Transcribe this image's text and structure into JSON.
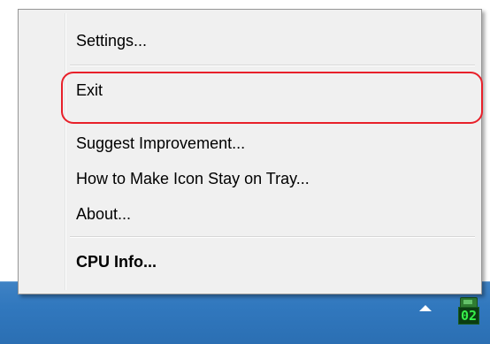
{
  "menu": {
    "items": [
      {
        "label": "Settings..."
      },
      {
        "label": "Exit"
      },
      {
        "label": "Suggest Improvement..."
      },
      {
        "label": "How to Make Icon Stay on Tray..."
      },
      {
        "label": "About..."
      },
      {
        "label": "CPU Info..."
      }
    ],
    "highlight_color": "#e8202a"
  },
  "tray": {
    "app_icon_number": "02",
    "app_icon_name": "cpu-core-temp-icon",
    "overflow_icon_name": "show-hidden-icons-arrow"
  },
  "colors": {
    "taskbar": "#3178be",
    "menu_background": "#f0f0f0"
  }
}
